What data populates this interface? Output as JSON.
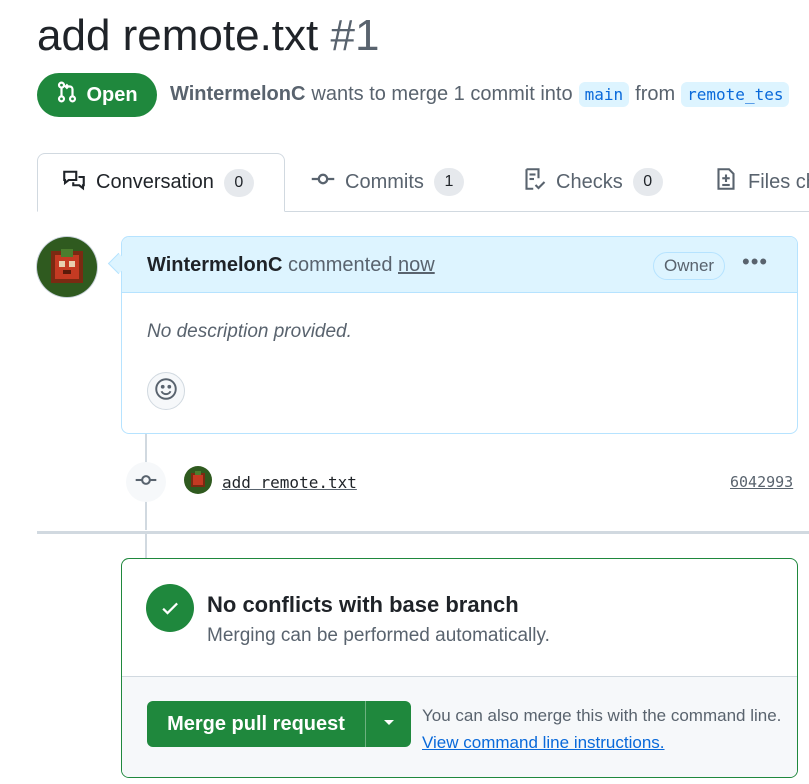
{
  "pr": {
    "title": "add remote.txt",
    "number": "#1",
    "state": "Open",
    "author": "WintermelonC",
    "merge_text": "wants to merge 1 commit into",
    "base_branch": "main",
    "from_text": "from",
    "head_branch": "remote_tes"
  },
  "tabs": [
    {
      "label": "Conversation",
      "count": "0",
      "icon": "comment-discussion-icon"
    },
    {
      "label": "Commits",
      "count": "1",
      "icon": "git-commit-icon"
    },
    {
      "label": "Checks",
      "count": "0",
      "icon": "checklist-icon"
    },
    {
      "label": "Files ch",
      "icon": "file-diff-icon"
    }
  ],
  "comment": {
    "author": "WintermelonC",
    "action": "commented",
    "time": "now",
    "role": "Owner",
    "more": "•••",
    "body": "No description provided."
  },
  "commit": {
    "message": "add remote.txt",
    "sha": "6042993"
  },
  "merge": {
    "title": "No conflicts with base branch",
    "subtitle": "Merging can be performed automatically.",
    "button": "Merge pull request",
    "hint": "You can also merge this with the command line.",
    "link": "View command line instructions."
  },
  "colors": {
    "open_green": "#1f883d",
    "link_blue": "#0969da",
    "comment_header": "#ddf4ff"
  }
}
